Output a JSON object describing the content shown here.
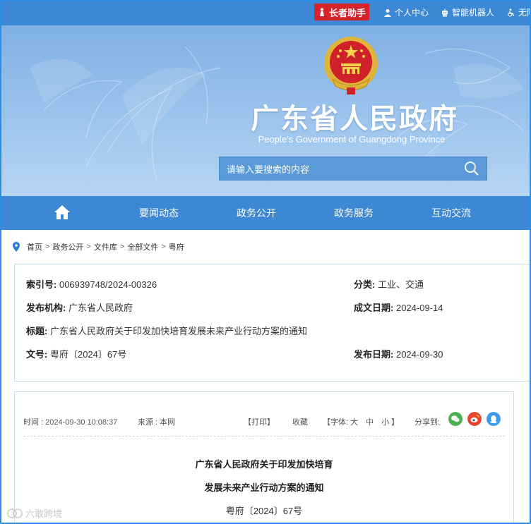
{
  "topbar": {
    "elder_label": "长者助手",
    "personal_center": "个人中心",
    "robot": "智能机器人",
    "accessible": "无障"
  },
  "banner": {
    "title": "广东省人民政府",
    "subtitle": "People's Government of Guangdong Province",
    "search_placeholder": "请输入要搜索的内容"
  },
  "nav": {
    "items": [
      "要闻动态",
      "政务公开",
      "政务服务",
      "互动交流"
    ]
  },
  "breadcrumb": [
    "首页",
    "政务公开",
    "文件库",
    "全部文件",
    "粤府"
  ],
  "info": {
    "index_label": "索引号:",
    "index_value": "006939748/2024-00326",
    "category_label": "分类:",
    "category_value": "工业、交通",
    "org_label": "发布机构:",
    "org_value": "广东省人民政府",
    "created_label": "成文日期:",
    "created_value": "2024-09-14",
    "title_label": "标题:",
    "title_value": "广东省人民政府关于印发加快培育发展未来产业行动方案的通知",
    "docno_label": "文号:",
    "docno_value": "粤府〔2024〕67号",
    "published_label": "发布日期:",
    "published_value": "2024-09-30"
  },
  "article": {
    "time": "时间 : 2024-09-30 10:08:37",
    "source": "来源 : 本网",
    "print": "【打印】",
    "favorite": "收藏",
    "font_size": "【字体: 大　中　小 】",
    "share_label": "分享到:",
    "title_line1": "广东省人民政府关于印发加快培育",
    "title_line2": "发展未来产业行动方案的通知",
    "doc_number": "粤府〔2024〕67号"
  },
  "watermark": "六敢跨境",
  "colors": {
    "primary": "#3d88d4",
    "elder_red": "#d4232a",
    "wechat": "#4caf50",
    "weibo": "#e6462e",
    "qq": "#3d9be9"
  }
}
